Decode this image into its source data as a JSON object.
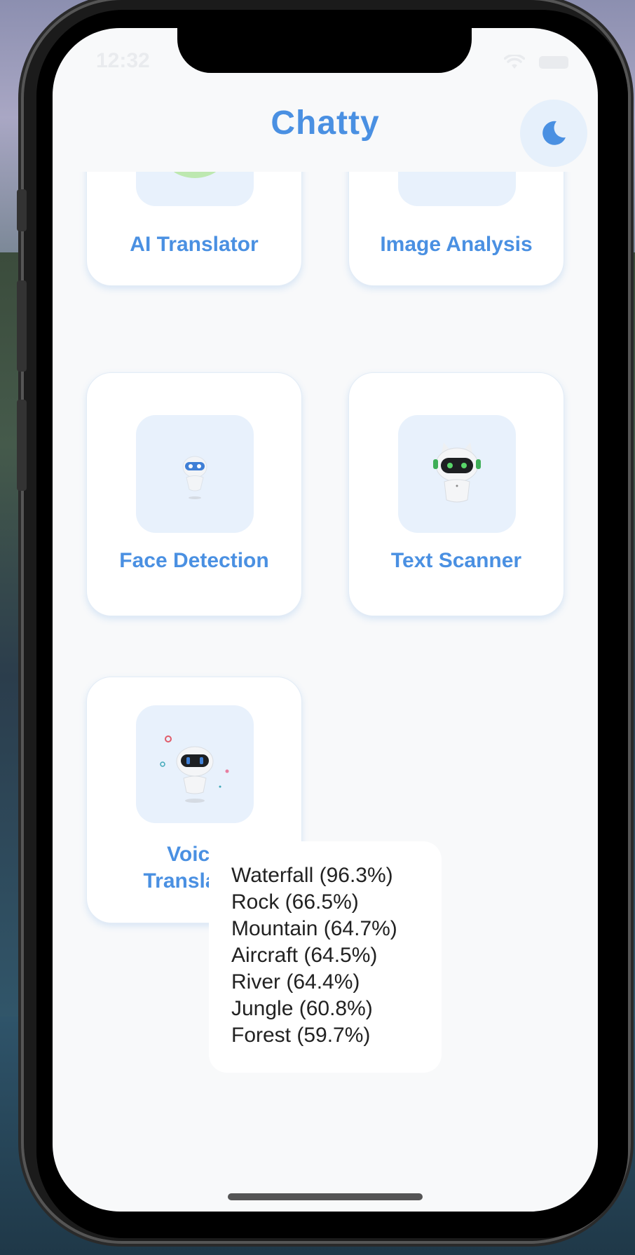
{
  "status_bar": {
    "time": "12:32"
  },
  "header": {
    "title": "Chatty"
  },
  "theme_toggle": {
    "icon": "moon-icon"
  },
  "cards": [
    {
      "label": "AI Translator",
      "icon": "translator-globe-icon"
    },
    {
      "label": "Image Analysis",
      "icon": "image-analysis-icon"
    },
    {
      "label": "Face Detection",
      "icon": "face-robot-icon"
    },
    {
      "label": "Text Scanner",
      "icon": "cat-robot-icon"
    },
    {
      "label_line1": "Voice",
      "label_line2": "Translator",
      "icon": "voice-robot-icon"
    }
  ],
  "results": [
    "Waterfall (96.3%)",
    "Rock (66.5%)",
    "Mountain (64.7%)",
    "Aircraft (64.5%)",
    "River (64.4%)",
    "Jungle (60.8%)",
    "Forest (59.7%)"
  ],
  "colors": {
    "accent": "#4a90e2",
    "card_icon_bg": "#e8f1fc",
    "screen_bg": "#f8f9fa"
  }
}
